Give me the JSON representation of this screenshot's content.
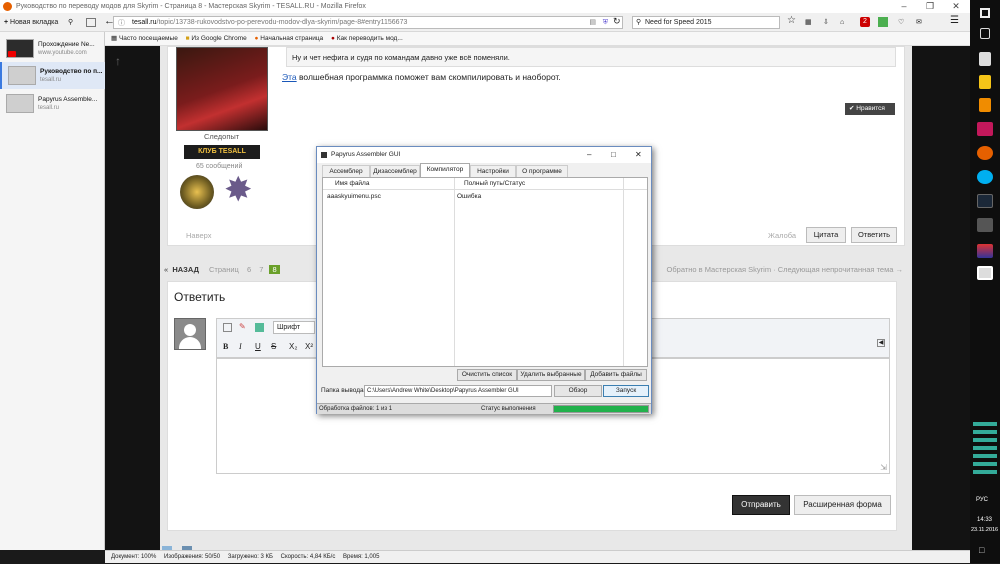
{
  "browser": {
    "window_title": "Руководство по переводу модов для Skyrim - Страница 8 - Мастерская Skyrim - TESALL.RU - Mozilla Firefox",
    "new_tab_label": "Новая вкладка",
    "url_host": "tesall.ru",
    "url_path": "/topic/13738-rukovodstvo-po-perevodu-modov-dlya-skyrim/page-8#entry1156673",
    "search_value": "Need for Speed 2015",
    "bookmarks": [
      "Часто посещаемые",
      "Из Google Chrome",
      "Начальная страница",
      "Как переводить мод..."
    ],
    "notification_count": "2"
  },
  "sidebar": {
    "tabs": [
      {
        "title": "Прохождение Ne...",
        "url": "www.youtube.com"
      },
      {
        "title": "Руководство по п...",
        "url": "tesall.ru"
      },
      {
        "title": "Papyrus Assemble...",
        "url": "tesall.ru"
      }
    ]
  },
  "post": {
    "quote_text": "Ну и чет нефига и судя по командам давно уже всё поменяли.",
    "link_text": "Эта",
    "body_rest": " волшебная программка поможет вам скомпилировать и наоборот.",
    "like_label": "Нравится",
    "user_rank": "Следопыт",
    "club_badge": "КЛУБ TESALL",
    "messages_count": "65 сообщений",
    "top_link": "Наверх",
    "complain": "Жалоба",
    "quote_btn": "Цитата",
    "reply_btn": "Ответить"
  },
  "pagination": {
    "back": "НАЗАД",
    "pages_label": "Страниц",
    "pages": [
      "6",
      "7",
      "8"
    ],
    "current": "8",
    "right_text": "Обратно в Мастерская Skyrim · Следующая непрочитанная тема →"
  },
  "reply": {
    "title": "Ответить",
    "font_placeholder": "Шрифт",
    "send": "Отправить",
    "advanced": "Расширенная форма"
  },
  "dialog": {
    "title": "Papyrus Assembler GUI",
    "tabs": [
      "Ассемблер",
      "Дизассемблер",
      "Компилятор",
      "Настройки",
      "О программе"
    ],
    "active_tab": "Компилятор",
    "columns": [
      "Имя файла",
      "Полный путь/Статус"
    ],
    "rows": [
      {
        "file": "aaaskyuimenu.psc",
        "status": "Ошибка"
      }
    ],
    "buttons": {
      "clear": "Очистить список",
      "delete": "Удалить выбранные",
      "add": "Добавить файлы"
    },
    "output_label": "Папка вывода:",
    "output_path": "C:\\Users\\Andrew White\\Desktop\\Papyrus Assembler GUI",
    "browse": "Обзор",
    "run": "Запуск",
    "status_processed": "Обработка файлов: 1 из 1",
    "status_label": "Статус выполнения",
    "progress": 1.0,
    "progress_color": "#22b14c"
  },
  "statusbar": {
    "doc": "Документ: 100%",
    "images": "Изображения: 50/50",
    "loaded": "Загружено: 3 КБ",
    "speed": "Скорость: 4,84 КБ/с",
    "time": "Время: 1,005"
  },
  "taskbar": {
    "lang": "РУС",
    "time": "14:33",
    "date": "23.11.2016"
  }
}
